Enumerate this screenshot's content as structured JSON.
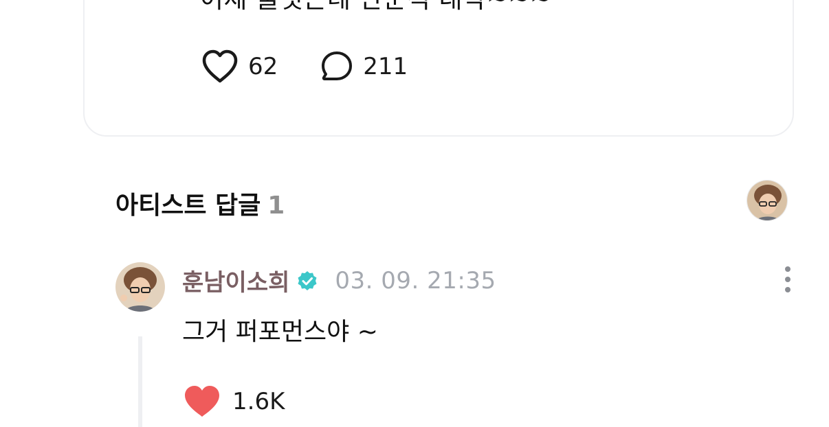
{
  "post": {
    "text": "어제 울엇는데 안운척 대박~~~",
    "like_count": "62",
    "comment_count": "211",
    "avatar_icon": "rainbow-character-avatar"
  },
  "artist_replies": {
    "title": "아티스트 답글",
    "count": "1",
    "header_avatar_icon": "artist-avatar"
  },
  "reply": {
    "author": "훈남이소희",
    "verified_icon": "verified-badge-icon",
    "timestamp": "03. 09. 21:35",
    "text": "그거 퍼포먼스야 ~",
    "like_count": "1.6K",
    "liked": true
  },
  "colors": {
    "like_filled": "#ef5b5b",
    "verified": "#3cc7c9",
    "author": "#7a5f63",
    "timestamp": "#a5a9b0",
    "card_border": "#eeeff2"
  }
}
